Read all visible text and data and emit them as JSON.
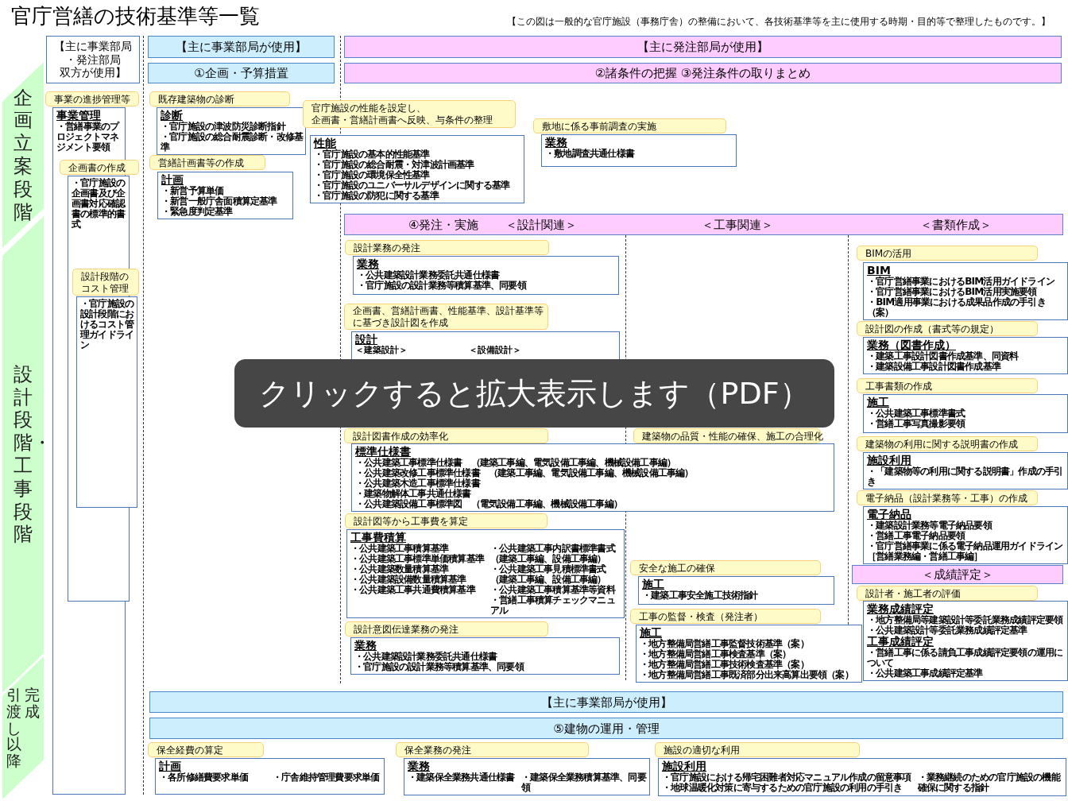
{
  "title": "官庁営繕の技術基準等一覧",
  "note": "【この図は一般的な官庁施設（事務庁舎）の整備において、各技術基準等を主に使用する時期・目的等で整理したものです。】",
  "stages": [
    {
      "lines": [
        "企画立案段階"
      ]
    },
    {
      "lines": [
        "設計段階・工事段階"
      ]
    },
    {
      "lines": [
        "引渡し以降",
        "完成"
      ]
    }
  ],
  "banners": [
    {
      "kind": "plain",
      "lines": [
        "【主に事業部局",
        "・発注部局",
        "双方が使用】"
      ]
    },
    {
      "kind": "blue",
      "lines": [
        "【主に事業部局が使用】"
      ]
    },
    {
      "kind": "blue",
      "lines": [
        "①企画・予算措置"
      ]
    },
    {
      "kind": "pink",
      "lines": [
        "【主に発注部局が使用】"
      ]
    },
    {
      "kind": "pink",
      "lines": [
        "②諸条件の把握 ③発注条件の取りまとめ"
      ]
    },
    {
      "kind": "band",
      "segments": [
        [
          "④発注・実施",
          "＜設計関連＞"
        ],
        [
          "＜工事関連＞"
        ],
        [
          "＜書類作成＞"
        ]
      ]
    },
    {
      "kind": "pink",
      "lines": [
        "＜成績評定＞"
      ]
    },
    {
      "kind": "blue",
      "lines": [
        "【主に事業部局が使用】"
      ]
    },
    {
      "kind": "blue",
      "lines": [
        "⑤建物の運用・管理"
      ]
    }
  ],
  "groups": [
    {
      "tag": [
        "事業の進捗管理等"
      ],
      "blocks": [
        {
          "title": "事業管理",
          "items": [
            "・営繕事業のプロジェクトマネジメント要領"
          ]
        }
      ]
    },
    {
      "tag": [
        "企画書の作成"
      ],
      "blocks": [
        {
          "items": [
            "・官庁施設の企画書及び企画書対応確認書の標準的書式"
          ]
        }
      ]
    },
    {
      "tag": [
        "設計段階の",
        "コスト管理"
      ],
      "blocks": [
        {
          "items": [
            "・官庁施設の設計段階におけるコスト管理ガイドライン"
          ]
        }
      ]
    },
    {
      "tag": [
        "既存建築物の診断"
      ],
      "blocks": [
        {
          "title": "診断",
          "items": [
            "・官庁施設の津波防災診断指針",
            "・官庁施設の総合耐震診断・改修基準"
          ]
        }
      ]
    },
    {
      "tag": [
        "営繕計画書等の作成"
      ],
      "blocks": [
        {
          "title": "計画",
          "items": [
            "・新営予算単価",
            "・新営一般庁舎面積算定基準",
            "・緊急度判定基準"
          ]
        }
      ]
    },
    {
      "tag": [
        "官庁施設の性能を設定し、",
        "企画書・営繕計画書へ反映、与条件の整理"
      ],
      "blocks": [
        {
          "title": "性能",
          "items": [
            "・官庁施設の基本的性能基準",
            "・官庁施設の総合耐震・対津波計画基準",
            "・官庁施設の環境保全性基準",
            "・官庁施設のユニバーサルデザインに関する基準",
            "・官庁施設の防犯に関する基準"
          ]
        }
      ]
    },
    {
      "tag": [
        "敷地に係る事前調査の実施"
      ],
      "blocks": [
        {
          "title": "業務",
          "items": [
            "・敷地調査共通仕様書"
          ]
        }
      ]
    },
    {
      "tag": [
        "設計業務の発注"
      ],
      "blocks": [
        {
          "title": "業務",
          "items": [
            "・公共建築設計業務委託共通仕様書",
            "・官庁施設の設計業務等積算基準、同要領"
          ]
        }
      ]
    },
    {
      "tag": [
        "企画書、営繕計画書、性能基準、設計基準等",
        "に基づき設計図を作成"
      ],
      "blocks": [
        {
          "title": "設計",
          "columns": [
            [
              {
                "heading": "＜建築設計＞"
              }
            ],
            [
              {
                "heading": "＜設備設計＞"
              }
            ]
          ]
        }
      ]
    },
    {
      "tag": [
        "設計図書作成の効率化"
      ],
      "blocks": [
        {
          "title": "標準仕様書",
          "items": [
            "・公共建築工事標準仕様書　（建築工事編、電気設備工事編、機械設備工事編）",
            "・公共建築改修工事標準仕様書　（建築工事編、電気設備工事編、機械設備工事編）",
            "・公共建築木造工事標準仕様書",
            "・建築物解体工事共通仕様書",
            "・公共建築設備工事標準図　（電気設備工事編、機械設備工事編）"
          ]
        }
      ]
    },
    {
      "tag": [
        "建築物の品質・性能の確保、施工の合理化"
      ]
    },
    {
      "tag": [
        "設計図等から工事費を算定"
      ],
      "blocks": [
        {
          "title": "工事費積算",
          "columns": [
            [
              {
                "items": [
                  "・公共建築工事積算基準",
                  "・公共建築工事標準単価積算基準",
                  "・公共建築数量積算基準",
                  "・公共建築設備数量積算基準",
                  "・公共建築工事共通費積算基準"
                ]
              }
            ],
            [
              {
                "items": [
                  "・公共建築工事内訳書標準書式",
                  "（建築工事編、設備工事編）",
                  "・公共建築工事見積標準書式",
                  "（建築工事編、設備工事編）",
                  "・公共建築工事積算基準等資料",
                  "・営繕工事積算チェックマニュアル"
                ]
              }
            ]
          ]
        }
      ]
    },
    {
      "tag": [
        "設計意図伝達業務の発注"
      ],
      "blocks": [
        {
          "title": "業務",
          "items": [
            "・公共建築設計業務委託共通仕様書",
            "・官庁施設の設計業務等積算基準、同要領"
          ]
        }
      ]
    },
    {
      "tag": [
        "安全な施工の確保"
      ],
      "blocks": [
        {
          "title": "施工",
          "items": [
            "・建築工事安全施工技術指針"
          ]
        }
      ]
    },
    {
      "tag": [
        "工事の監督・検査（発注者）"
      ],
      "blocks": [
        {
          "title": "施工",
          "items": [
            "・地方整備局営繕工事監督技術基準（案）",
            "・地方整備局営繕工事検査基準（案）",
            "・地方整備局営繕工事技術検査基準（案）",
            "・地方整備局営繕工事既済部分出来高算出要領（案）"
          ]
        }
      ]
    },
    {
      "tag": [
        "BIMの活用"
      ],
      "blocks": [
        {
          "title": "BIM",
          "items": [
            "・官庁営繕事業におけるBIM活用ガイドライン",
            "・官庁営繕事業におけるBIM活用実施要領",
            "・BIM適用事業における成果品作成の手引き（案）"
          ]
        }
      ]
    },
    {
      "tag": [
        "設計図の作成（書式等の規定）"
      ],
      "blocks": [
        {
          "title": "業務（図書作成）",
          "items": [
            "・建築工事設計図書作成基準、同資料",
            "・建築設備工事設計図書作成基準"
          ]
        }
      ]
    },
    {
      "tag": [
        "工事書類の作成"
      ],
      "blocks": [
        {
          "title": "施工",
          "items": [
            "・公共建築工事標準書式",
            "・営繕工事写真撮影要領"
          ]
        }
      ]
    },
    {
      "tag": [
        "建築物の利用に関する説明書の作成"
      ],
      "blocks": [
        {
          "title": "施設利用",
          "items": [
            "・「建築物等の利用に関する説明書」作成の手引き"
          ]
        }
      ]
    },
    {
      "tag": [
        "電子納品（設計業務等・工事）の作成"
      ],
      "blocks": [
        {
          "title": "電子納品",
          "items": [
            "・建築設計業務等電子納品要領",
            "・営繕工事電子納品要領",
            "・官庁営繕事業に係る電子納品運用ガイドライン",
            "［営繕業務編・営繕工事編］"
          ]
        }
      ]
    },
    {
      "tag": [
        "設計者・施工者の評価"
      ],
      "blocks": [
        {
          "title": "業務成績評定",
          "items": [
            "・地方整備局等建築設計等委託業務成績評定要領",
            "・公共建築設計等委託業務成績評定基準"
          ]
        },
        {
          "title": "工事成績評定",
          "items": [
            "・営繕工事に係る請負工事成績評定要領の運用について",
            "・公共建築工事成績評定基準"
          ]
        }
      ]
    },
    {
      "tag": [
        "保全経費の算定"
      ],
      "blocks": [
        {
          "title": "計画",
          "columns": [
            [
              {
                "items": [
                  "・各所修繕費要求単価"
                ]
              }
            ],
            [
              {
                "items": [
                  "・庁舎維持管理費要求単価"
                ]
              }
            ]
          ]
        }
      ]
    },
    {
      "tag": [
        "保全業務の発注"
      ],
      "blocks": [
        {
          "title": "業務",
          "columns": [
            [
              {
                "items": [
                  "・建築保全業務共通仕様書"
                ]
              }
            ],
            [
              {
                "items": [
                  "・建築保全業務積算基準、同要領"
                ]
              }
            ]
          ]
        }
      ]
    },
    {
      "tag": [
        "施設の適切な利用"
      ],
      "blocks": [
        {
          "title": "施設利用",
          "columns": [
            [
              {
                "items": [
                  "・官庁施設における帰宅困難者対応マニュアル作成の留意事項",
                  "・地球温暖化対策に寄与するための官庁施設の利用の手引き"
                ]
              }
            ],
            [
              {
                "items": [
                  "・業務継続のための官庁施設の機能確保に関する指針"
                ]
              }
            ]
          ]
        }
      ]
    }
  ],
  "overlay": "クリックすると拡大表示します（PDF）"
}
